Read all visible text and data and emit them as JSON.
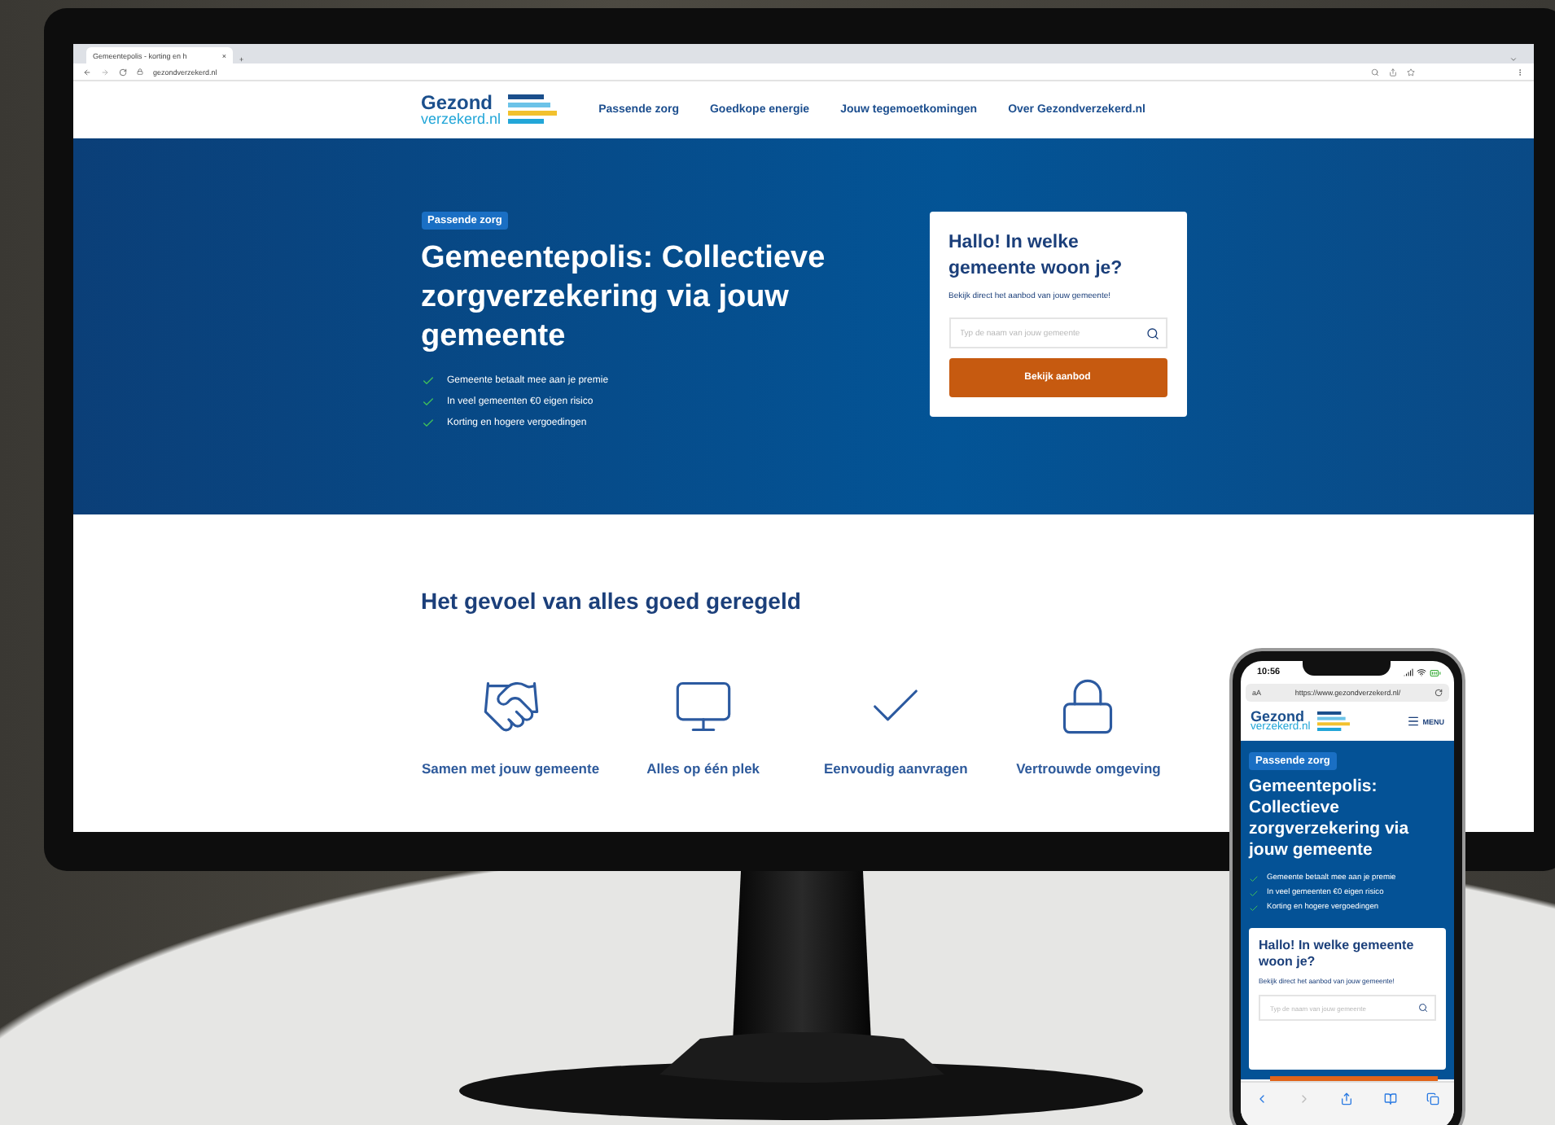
{
  "browser": {
    "tab_title": "Gemeentepolis - korting en h",
    "tab_close": "×",
    "new_tab": "+",
    "address": "gezondverzekerd.nl"
  },
  "site": {
    "logo": {
      "line_1": "Gezond",
      "line_2": "verzekerd.nl"
    },
    "nav": [
      "Passende zorg",
      "Goedkope energie",
      "Jouw tegemoetkomingen",
      "Over Gezondverzekerd.nl"
    ],
    "hero": {
      "tag": "Passende zorg",
      "title": "Gemeentepolis: Collectieve zorgverzekering via jouw gemeente",
      "checks": [
        "Gemeente betaalt mee aan je premie",
        "In veel gemeenten €0 eigen risico",
        "Korting en hogere vergoedingen"
      ]
    },
    "card": {
      "title": "Hallo! In welke gemeente woon je?",
      "subtitle": "Bekijk direct het aanbod van jouw gemeente!",
      "placeholder": "Typ de naam van jouw gemeente",
      "button": "Bekijk aanbod"
    },
    "features": {
      "title": "Het gevoel van alles goed geregeld",
      "items": [
        {
          "kind": "handshake",
          "label": "Samen met jouw gemeente"
        },
        {
          "kind": "monitor",
          "label": "Alles op één plek"
        },
        {
          "kind": "check",
          "label": "Eenvoudig aanvragen"
        },
        {
          "kind": "lock",
          "label": "Vertrouwde omgeving"
        }
      ]
    }
  },
  "phone": {
    "time": "10:56",
    "text_size": "aA",
    "address": "https://www.gezondverzekerd.nl/",
    "menu": "MENU",
    "logo": {
      "line_1": "Gezond",
      "line_2": "verzekerd.nl"
    },
    "hero": {
      "tag": "Passende zorg",
      "title": "Gemeentepolis: Collectieve zorgverzekering via jouw gemeente",
      "checks": [
        "Gemeente betaalt mee aan je premie",
        "In veel gemeenten €0 eigen risico",
        "Korting en hogere vergoedingen"
      ]
    },
    "card": {
      "title": "Hallo! In welke gemeente woon je?",
      "subtitle": "Bekijk direct het aanbod van jouw gemeente!",
      "placeholder": "Typ de naam van jouw gemeente"
    }
  }
}
